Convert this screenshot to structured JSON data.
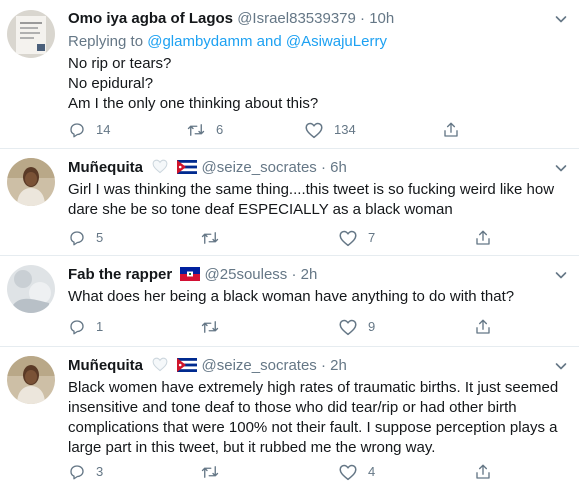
{
  "tweets": [
    {
      "name": "Omo iya agba of Lagos",
      "handle": "@Israel83539379",
      "time": "10h",
      "replying_prefix": "Replying to",
      "replying_user1": "@glambydamm",
      "replying_and": "and",
      "replying_user2": "@AsiwajuLerry",
      "lines": [
        "No rip or tears?",
        "No epidural?",
        "Am I the only one thinking about this?"
      ],
      "replies": "14",
      "retweets": "6",
      "likes": "134"
    },
    {
      "name": "Muñequita",
      "handle": "@seize_socrates",
      "time": "6h",
      "lines": [
        "Girl I was thinking the same thing....this tweet is so fucking weird like how",
        "dare she be so tone deaf ESPECIALLY as a black woman"
      ],
      "replies": "5",
      "retweets": "",
      "likes": "7"
    },
    {
      "name": "Fab the rapper",
      "handle": "@25souless",
      "time": "2h",
      "lines": [
        "What does her being a black woman have anything to do with that?"
      ],
      "replies": "1",
      "retweets": "",
      "likes": "9"
    },
    {
      "name": "Muñequita",
      "handle": "@seize_socrates",
      "time": "2h",
      "lines": [
        "Black women have extremely high rates of traumatic births. It just seemed",
        "insensitive and tone deaf to those who did tear/rip or had other birth",
        "complications that were 100% not their fault. I suppose perception plays a",
        "large part in this tweet, but it rubbed me the wrong way."
      ],
      "replies": "3",
      "retweets": "",
      "likes": "4"
    }
  ],
  "separator_dot": "·",
  "icons": {
    "reply": "reply-icon",
    "retweet": "retweet-icon",
    "like": "heart-icon",
    "share": "share-icon",
    "caret": "chevron-down-icon",
    "white_heart": "white-heart-emoji",
    "cuba_flag": "cuba-flag-emoji",
    "haiti_flag": "haiti-flag-emoji"
  },
  "colors": {
    "text": "#14171a",
    "muted": "#657786",
    "link": "#1da1f2",
    "divider": "#e6ecf0"
  }
}
